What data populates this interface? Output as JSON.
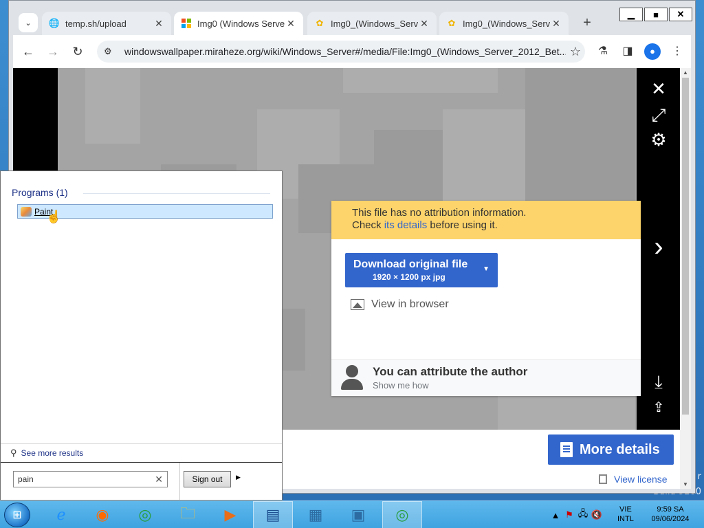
{
  "desktop": {
    "text_right": "r",
    "build": "Build 9200"
  },
  "window_controls": {
    "minimize": "▁",
    "maximize": "■",
    "close": "✕"
  },
  "tabs": [
    {
      "title": "temp.sh/upload",
      "favicon": "globe-icon",
      "active": false
    },
    {
      "title": "Img0 (Windows Serve",
      "favicon": "windows-flag-icon",
      "active": true
    },
    {
      "title": "Img0_(Windows_Serv",
      "favicon": "wiki-flower-icon",
      "active": false
    },
    {
      "title": "Img0_(Windows_Serv",
      "favicon": "wiki-flower-icon",
      "active": false
    }
  ],
  "tab_close": "✕",
  "new_tab": "+",
  "toolbar": {
    "url": "windowswallpaper.miraheze.org/wiki/Windows_Server#/media/File:Img0_(Windows_Server_2012_Bet..."
  },
  "popup": {
    "attr_line1": "This file has no attribution information.",
    "attr_check": "Check ",
    "attr_link": "its details",
    "attr_after": " before using it.",
    "download_label": "Download original file",
    "download_sub": "1920 × 1200 px jpg",
    "view_browser": "View in browser",
    "attr_title": "You can attribute the author",
    "attr_sub": "Show me how"
  },
  "bottom": {
    "more_details": "More details",
    "view_license": "View license"
  },
  "start_menu": {
    "programs_header": "Programs (1)",
    "program_item": "Paint",
    "see_more": "See more results",
    "search_value": "pain",
    "sign_out": "Sign out"
  },
  "taskbar": {
    "lang_top": "VIE",
    "lang_bottom": "INTL",
    "time": "9:59 SA",
    "date": "09/06/2024"
  },
  "colors": {
    "accent": "#3366cc",
    "attribution": "#fdd46b",
    "taskbar": "#4aaee6"
  }
}
